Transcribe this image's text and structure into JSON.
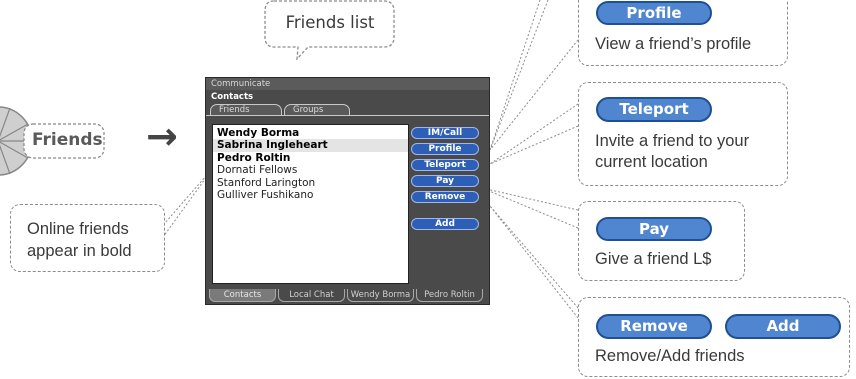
{
  "callouts": {
    "friends_list": "Friends list",
    "online_bold_line1": "Online friends",
    "online_bold_line2": "appear in bold",
    "profile_btn": "Profile",
    "profile_desc": "View a friend’s profile",
    "teleport_btn": "Teleport",
    "teleport_desc_line1": "Invite a friend to your",
    "teleport_desc_line2": "current location",
    "pay_btn": "Pay",
    "pay_desc": "Give a friend L$",
    "remove_btn": "Remove",
    "add_btn": "Add",
    "remove_add_desc": "Remove/Add friends"
  },
  "pie_menu": {
    "label": "Friends"
  },
  "arrow": {
    "glyph": "→"
  },
  "panel": {
    "title": "Communicate",
    "subtitle": "Contacts",
    "tabs": [
      "Friends",
      "Groups"
    ],
    "friends": [
      {
        "name": "Wendy Borma",
        "online": true,
        "selected": false
      },
      {
        "name": "Sabrina Ingleheart",
        "online": true,
        "selected": true
      },
      {
        "name": "Pedro Roltin",
        "online": true,
        "selected": false
      },
      {
        "name": "Dornati Fellows",
        "online": false,
        "selected": false
      },
      {
        "name": "Stanford Larington",
        "online": false,
        "selected": false
      },
      {
        "name": "Gulliver Fushikano",
        "online": false,
        "selected": false
      }
    ],
    "buttons": [
      "IM/Call",
      "Profile",
      "Teleport",
      "Pay",
      "Remove",
      "Add"
    ],
    "bottom_tabs": [
      "Contacts",
      "Local Chat",
      "Wendy Borma",
      "Pedro Roltin"
    ]
  },
  "colors": {
    "pill_fill": "#4f86cf",
    "pill_border": "#1f4f94",
    "panel_bg": "#4a4a4a",
    "panel_button": "#2e5fb8"
  }
}
